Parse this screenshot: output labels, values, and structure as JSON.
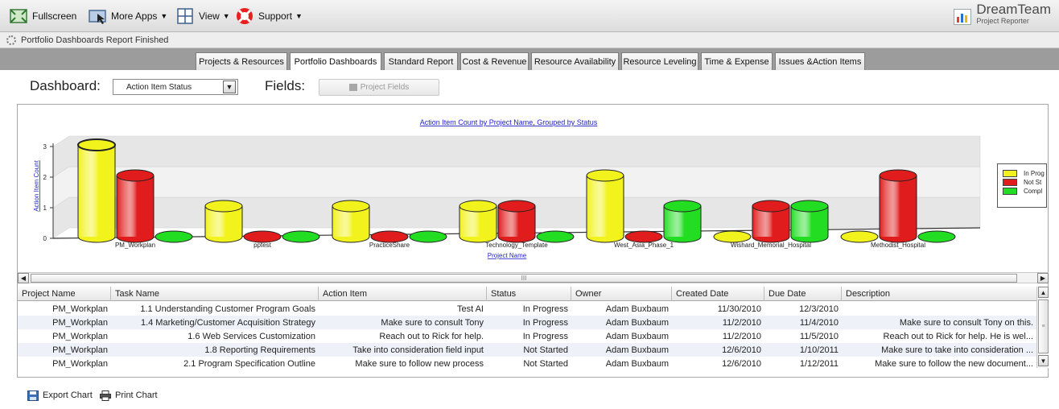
{
  "toolbar": {
    "fullscreen_label": "Fullscreen",
    "more_apps_label": "More Apps",
    "view_label": "View",
    "support_label": "Support"
  },
  "brand": {
    "title": "DreamTeam",
    "subtitle": "Project Reporter"
  },
  "status": {
    "text": "Portfolio Dashboards Report Finished"
  },
  "tabs": [
    {
      "label": "Projects & Resources",
      "active": false
    },
    {
      "label": "Portfolio Dashboards",
      "active": true
    },
    {
      "label": "Standard Report",
      "active": false
    },
    {
      "label": "Cost & Revenue",
      "active": false
    },
    {
      "label": "Resource Availability",
      "active": false
    },
    {
      "label": "Resource Leveling",
      "active": false
    },
    {
      "label": "Time & Expense",
      "active": false
    },
    {
      "label": "Issues &Action Items",
      "active": false
    }
  ],
  "dashboard": {
    "label": "Dashboard:",
    "selected": "Action Item Status",
    "fields_label": "Fields:",
    "fields_button": "Project Fields"
  },
  "chart_data": {
    "type": "bar",
    "title": "Action Item Count by Project Name, Grouped by Status",
    "xlabel": "Project Name",
    "ylabel": "Action Item Count",
    "ylim": [
      0,
      3
    ],
    "yticks": [
      "0",
      "1",
      "2",
      "3"
    ],
    "categories": [
      "PM_Workplan",
      "pptest",
      "PracticeShare",
      "Technology_Template",
      "West_Asia_Phase_1",
      "Wishard_Memorial_Hospital",
      "Methodist_Hospital"
    ],
    "series": [
      {
        "name": "In Prog",
        "color": "#f2f21c",
        "values": [
          3,
          1,
          1,
          1,
          2,
          0,
          0
        ]
      },
      {
        "name": "Not St",
        "color": "#e01c1c",
        "values": [
          2,
          0,
          0,
          1,
          0,
          1,
          2
        ]
      },
      {
        "name": "Compl",
        "color": "#22dd22",
        "values": [
          0,
          0,
          0,
          0,
          1,
          1,
          0
        ]
      }
    ],
    "legend_position": "right"
  },
  "grid": {
    "columns": [
      "Project Name",
      "Task Name",
      "Action Item",
      "Status",
      "Owner",
      "Created Date",
      "Due Date",
      "Description"
    ],
    "rows": [
      [
        "PM_Workplan",
        "1.1 Understanding Customer Program Goals",
        "Test AI",
        "In Progress",
        "Adam Buxbaum",
        "11/30/2010",
        "12/3/2010",
        ""
      ],
      [
        "PM_Workplan",
        "1.4 Marketing/Customer Acquisition Strategy",
        "Make sure to consult Tony",
        "In Progress",
        "Adam Buxbaum",
        "11/2/2010",
        "11/4/2010",
        "Make sure to consult Tony on this."
      ],
      [
        "PM_Workplan",
        "1.6 Web Services Customization",
        "Reach out to Rick for help.",
        "In Progress",
        "Adam Buxbaum",
        "11/2/2010",
        "11/5/2010",
        "Reach out to Rick for help. He is wel..."
      ],
      [
        "PM_Workplan",
        "1.8 Reporting Requirements",
        "Take into consideration field input",
        "Not Started",
        "Adam Buxbaum",
        "12/6/2010",
        "1/10/2011",
        "Make sure to take into consideration ..."
      ],
      [
        "PM_Workplan",
        "2.1 Program Specification Outline",
        "Make sure to follow new process",
        "Not Started",
        "Adam Buxbaum",
        "12/6/2010",
        "1/12/2011",
        "Make sure to follow the new document..."
      ]
    ]
  },
  "scroll": {
    "h_grip": "III",
    "v_grip": "≡"
  },
  "footer": {
    "export_label": "Export Chart",
    "print_label": "Print Chart"
  }
}
